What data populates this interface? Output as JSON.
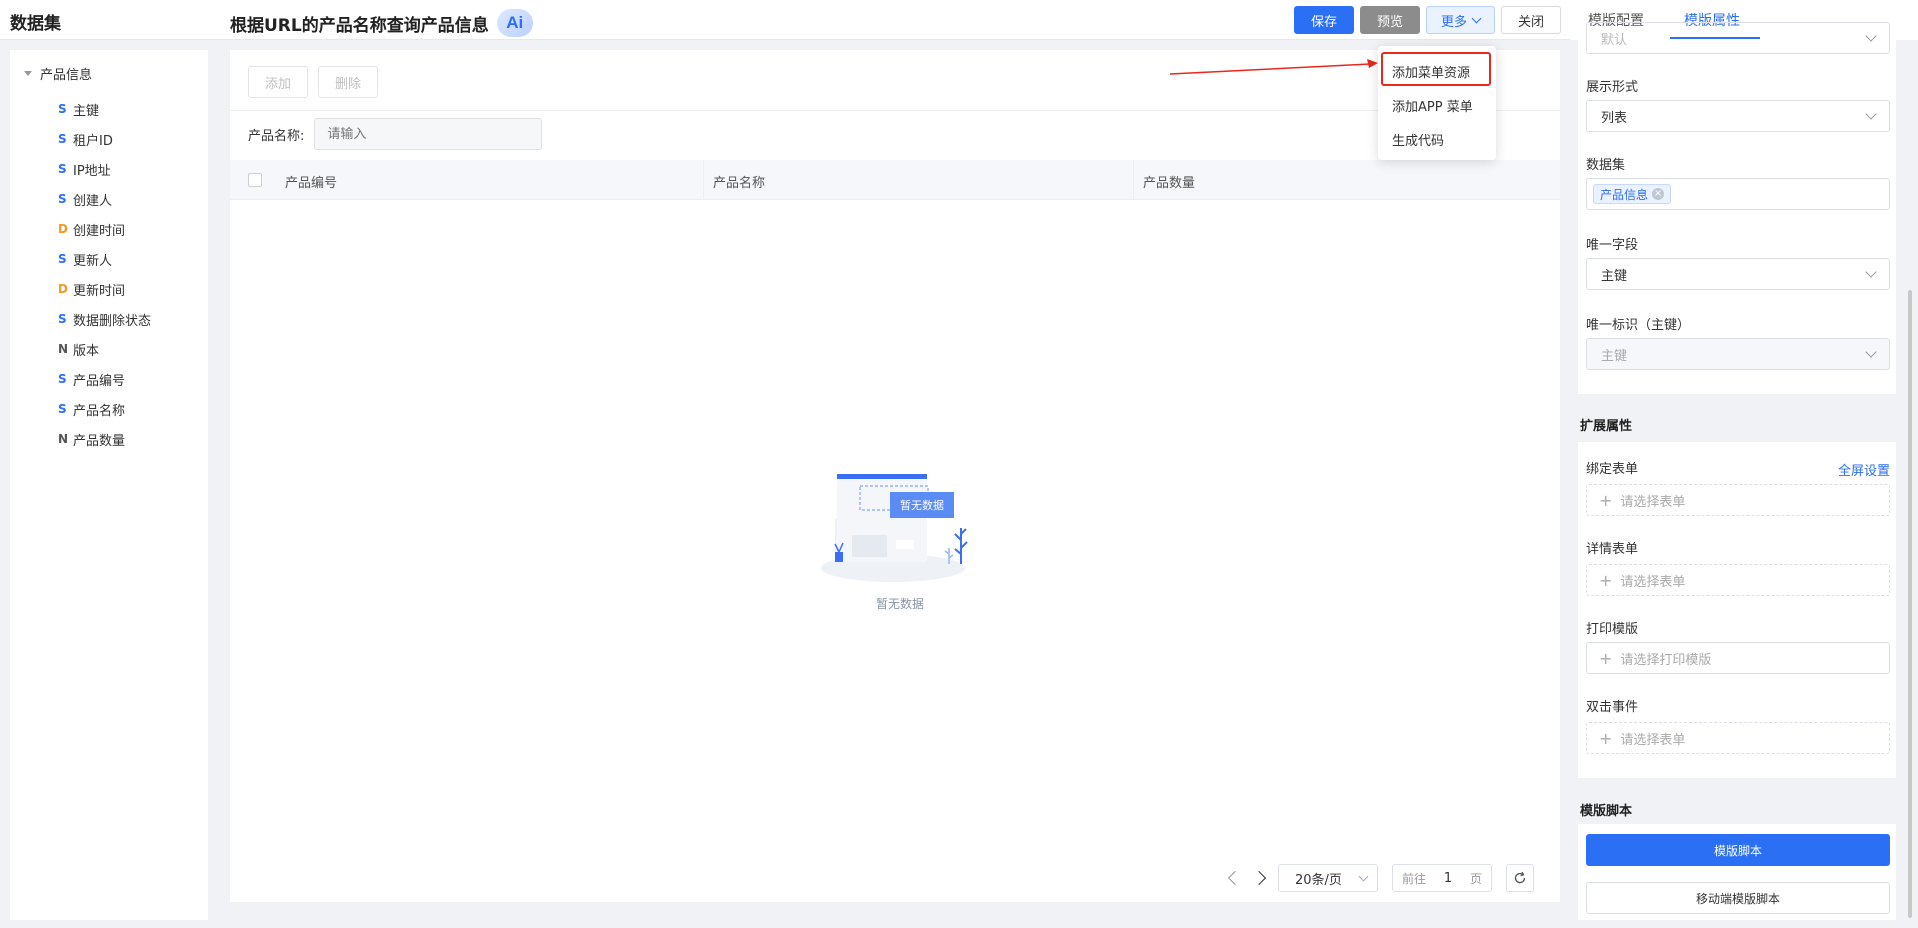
{
  "header": {
    "dataset_title": "数据集",
    "page_title": "根据URL的产品名称查询产品信息",
    "ai_badge": "Ai",
    "buttons": {
      "save": "保存",
      "preview": "预览",
      "more": "更多",
      "close": "关闭"
    }
  },
  "dropdown": {
    "items": [
      "添加菜单资源",
      "添加APP 菜单",
      "生成代码"
    ]
  },
  "sidebar": {
    "root": "产品信息",
    "fields": [
      {
        "type": "S",
        "label": "主键"
      },
      {
        "type": "S",
        "label": "租户ID"
      },
      {
        "type": "S",
        "label": "IP地址"
      },
      {
        "type": "S",
        "label": "创建人"
      },
      {
        "type": "D",
        "label": "创建时间"
      },
      {
        "type": "S",
        "label": "更新人"
      },
      {
        "type": "D",
        "label": "更新时间"
      },
      {
        "type": "S",
        "label": "数据删除状态"
      },
      {
        "type": "N",
        "label": "版本"
      },
      {
        "type": "S",
        "label": "产品编号"
      },
      {
        "type": "S",
        "label": "产品名称"
      },
      {
        "type": "N",
        "label": "产品数量"
      }
    ]
  },
  "main": {
    "add_button": "添加",
    "delete_button": "删除",
    "filter_label": "产品名称:",
    "filter_placeholder": "请输入",
    "columns": [
      "产品编号",
      "产品名称",
      "产品数量"
    ],
    "empty_badge": "暂无数据",
    "empty_text": "暂无数据",
    "pager": {
      "page_size": "20条/页",
      "goto_prefix": "前往",
      "goto_page": "1",
      "goto_suffix": "页"
    }
  },
  "right_panel": {
    "tabs": [
      "模版配置",
      "模版属性"
    ],
    "active_tab": 1,
    "top_select_partial": "默认",
    "display_label": "展示形式",
    "display_value": "列表",
    "dataset_label": "数据集",
    "dataset_tag": "产品信息",
    "unique_field_label": "唯一字段",
    "unique_field_value": "主键",
    "unique_id_label": "唯一标识（主键）",
    "unique_id_value": "主键",
    "ext_section": "扩展属性",
    "bind_form_label": "绑定表单",
    "fullscreen_link": "全屏设置",
    "bind_form_placeholder": "请选择表单",
    "detail_form_label": "详情表单",
    "detail_form_placeholder": "请选择表单",
    "print_label": "打印模版",
    "print_placeholder": "请选择打印模版",
    "dblclick_label": "双击事件",
    "dblclick_placeholder": "请选择表单",
    "script_section": "模版脚本",
    "script_button": "模版脚本",
    "mobile_script_button": "移动端模版脚本"
  },
  "colors": {
    "accent": "#2b6ff5",
    "highlight": "#e8281f",
    "date_type": "#f09a2a"
  }
}
